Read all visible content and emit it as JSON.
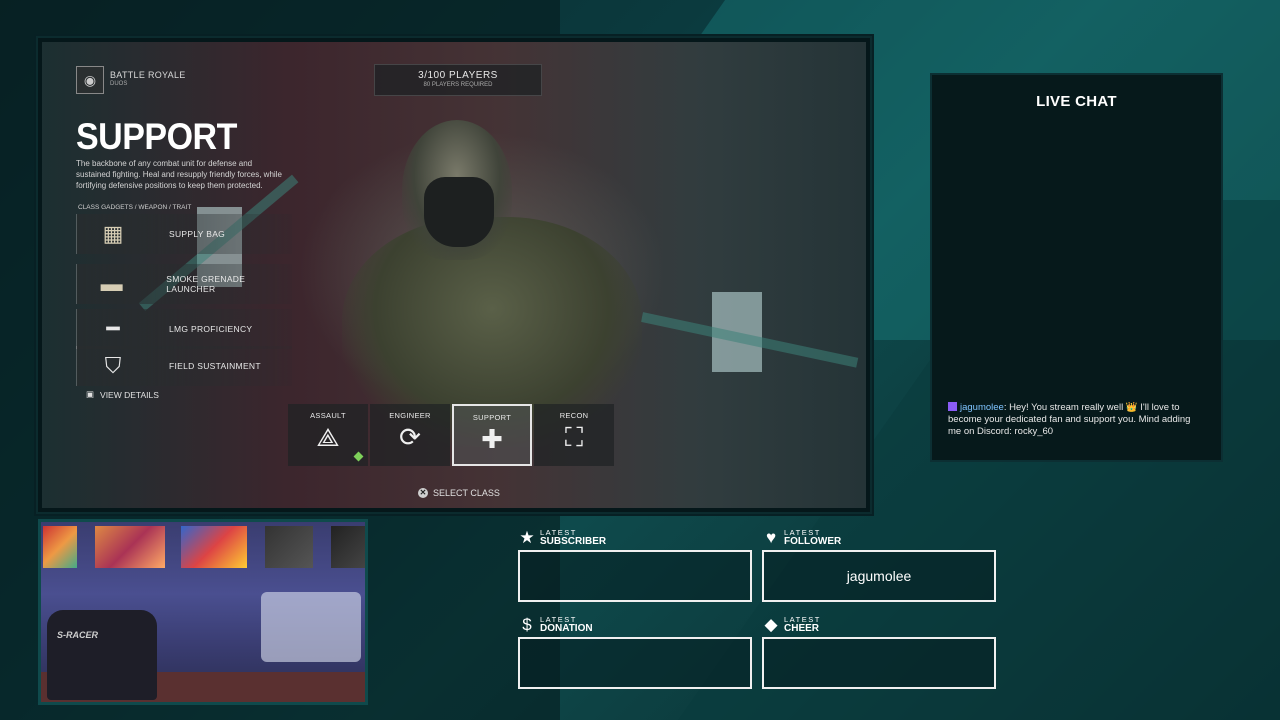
{
  "game": {
    "mode_title": "BATTLE ROYALE",
    "mode_sub": "DUOS",
    "players_count": "3/100 PLAYERS",
    "players_required": "80 PLAYERS REQUIRED",
    "class_title": "SUPPORT",
    "class_desc": "The backbone of any combat unit for defense and sustained fighting. Heal and resupply friendly forces, while fortifying defensive positions to keep them protected.",
    "gadgets_label": "CLASS GADGETS / WEAPON / TRAIT",
    "gadgets": [
      {
        "label": "SUPPLY BAG",
        "icon": "supply-bag-icon"
      },
      {
        "label": "SMOKE GRENADE LAUNCHER",
        "icon": "grenade-launcher-icon"
      },
      {
        "label": "LMG PROFICIENCY",
        "icon": "lmg-icon"
      },
      {
        "label": "FIELD SUSTAINMENT",
        "icon": "field-sustainment-icon"
      }
    ],
    "view_details": "VIEW DETAILS",
    "classes": [
      {
        "label": "ASSAULT",
        "icon": "assault-icon",
        "glyph": "⟁"
      },
      {
        "label": "ENGINEER",
        "icon": "engineer-icon",
        "glyph": "⟳"
      },
      {
        "label": "SUPPORT",
        "icon": "support-icon",
        "glyph": "✚"
      },
      {
        "label": "RECON",
        "icon": "recon-icon",
        "glyph": "⛶"
      }
    ],
    "selected_class": "SUPPORT",
    "select_class": "SELECT CLASS",
    "select_button_glyph": "✕"
  },
  "chat": {
    "title": "LIVE CHAT",
    "messages": [
      {
        "user": "jagumolee",
        "text": ": Hey! You stream really well 👑 I'll love to become your dedicated fan and support you. Mind adding me on Discord: rocky_60"
      }
    ]
  },
  "webcam": {
    "chair_text": "S-RACER"
  },
  "events": {
    "subscriber": {
      "small": "LATEST",
      "big": "SUBSCRIBER",
      "value": ""
    },
    "follower": {
      "small": "LATEST",
      "big": "FOLLOWER",
      "value": "jagumolee"
    },
    "donation": {
      "small": "LATEST",
      "big": "DONATION",
      "value": ""
    },
    "cheer": {
      "small": "LATEST",
      "big": "CHEER",
      "value": ""
    }
  },
  "colors": {
    "accent_teal": "#0e4a4c",
    "selected_border": "#e6e6e6",
    "chat_user": "#7fc4ff",
    "assault_dot": "#7ed05a"
  }
}
